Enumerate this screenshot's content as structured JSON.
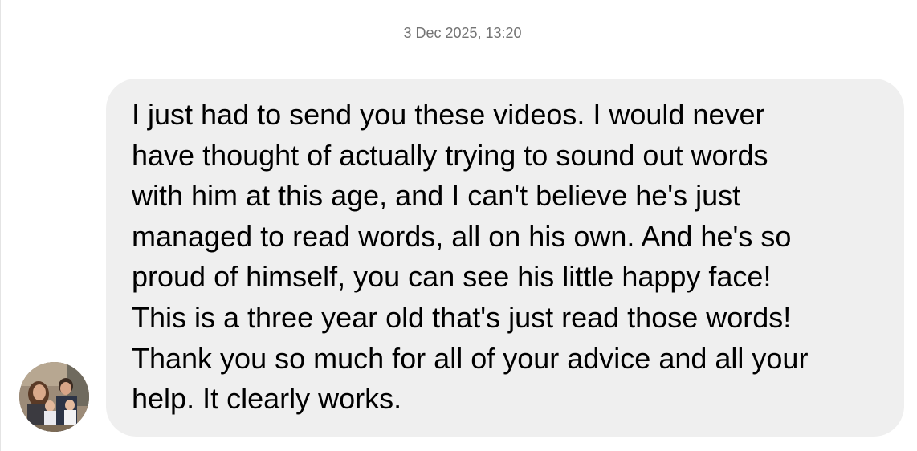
{
  "conversation": {
    "timestamp": "3 Dec 2025, 13:20",
    "message": {
      "lines": [
        "I just had to send you these videos. I would never",
        "have thought of actually trying to sound out words",
        "with him at this age, and I can't believe he's just",
        "managed to read words, all on his own. And he's so",
        "proud of himself, you can see his little happy face!",
        "This is a three year old that's just read those words!",
        "Thank you so much for all of your advice and all your",
        "help. It clearly works."
      ]
    },
    "sender": {
      "avatar_icon": "profile-photo-avatar"
    }
  },
  "colors": {
    "bubble_background": "#efefef",
    "timestamp_text": "#737373",
    "message_text": "#000000"
  }
}
